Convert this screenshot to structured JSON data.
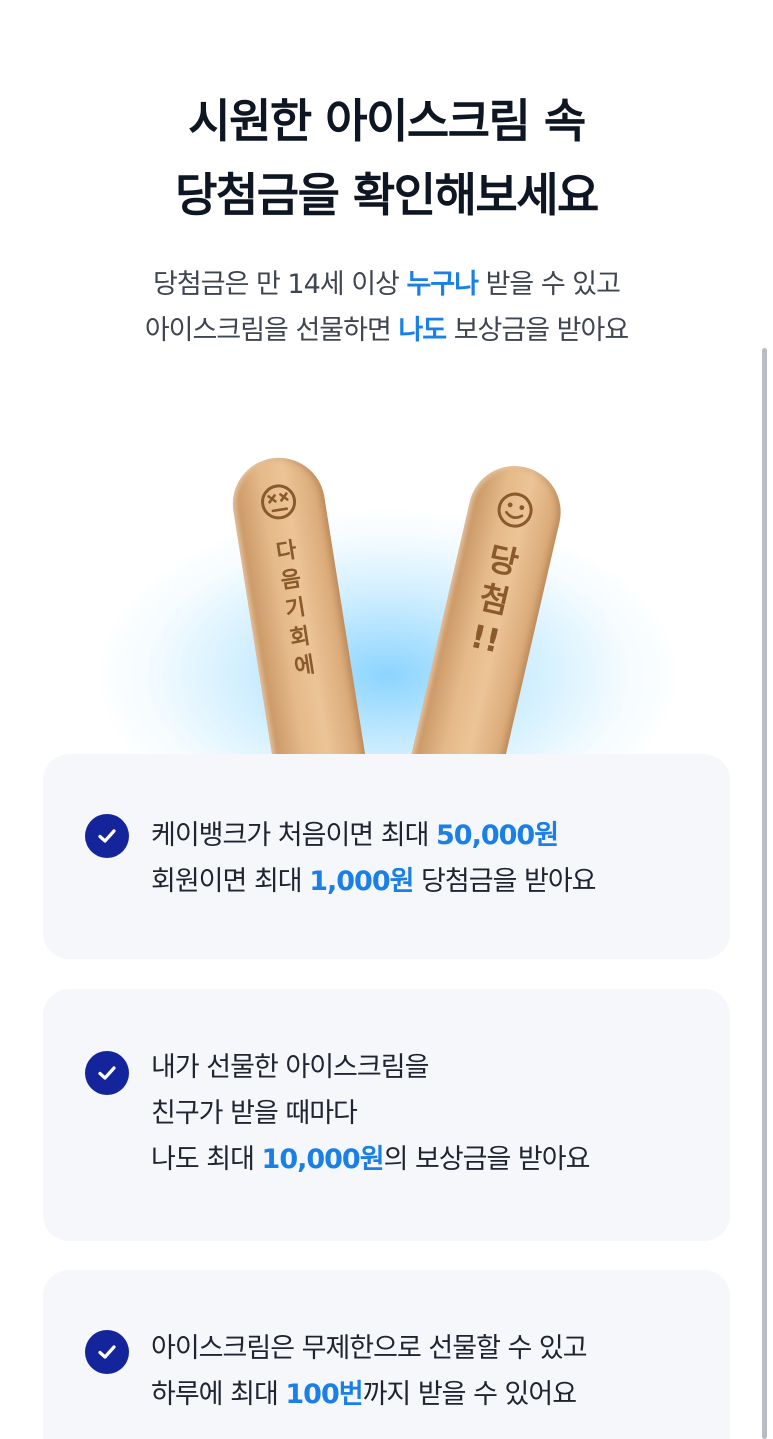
{
  "headline": {
    "line1": "시원한 아이스크림 속",
    "line2": "당첨금을 확인해보세요"
  },
  "subtitle": {
    "line1_pre": "당첨금은 만 14세 이상 ",
    "line1_hl": "누구나",
    "line1_post": " 받을 수 있고",
    "line2_pre": "아이스크림을 선물하면 ",
    "line2_hl": "나도",
    "line2_post": " 보상금을 받아요"
  },
  "hero": {
    "left_stick_text": [
      "다",
      "음",
      "기",
      "회",
      "에"
    ],
    "right_stick_text": [
      "당",
      "첨",
      "!!"
    ],
    "left_stick_icon": "dizzy-face-icon",
    "right_stick_icon": "smiley-face-icon"
  },
  "cards": [
    {
      "icon": "check-circle-icon",
      "line1_pre": "케이뱅크가 처음이면 최대 ",
      "line1_hl": "50,000원",
      "line2_pre": "회원이면 최대 ",
      "line2_hl": "1,000원",
      "line2_post": " 당첨금을 받아요"
    },
    {
      "icon": "check-circle-icon",
      "line1": "내가 선물한 아이스크림을",
      "line2": "친구가 받을 때마다",
      "line3_pre": "나도 최대 ",
      "line3_hl": "10,000원",
      "line3_post": "의 보상금을 받아요"
    },
    {
      "icon": "check-circle-icon",
      "line1": "아이스크림은 무제한으로 선물할 수 있고",
      "line2_pre": "하루에 최대 ",
      "line2_hl": "100번",
      "line2_post": "까지 받을 수 있어요"
    }
  ],
  "colors": {
    "accent": "#1a7fe6",
    "check": "#14249a",
    "card_bg": "#f5f7fb",
    "heading": "#0f1623"
  }
}
